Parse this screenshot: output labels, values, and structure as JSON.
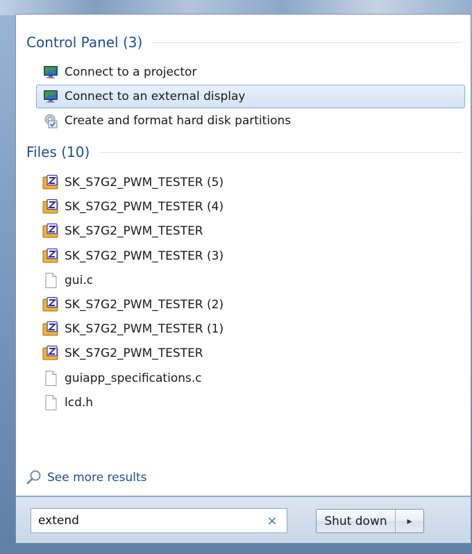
{
  "control_panel": {
    "header": "Control Panel (3)",
    "items": [
      {
        "label": "Connect to a projector",
        "icon": "monitor-icon",
        "selected": false
      },
      {
        "label": "Connect to an external display",
        "icon": "monitor-icon",
        "selected": true
      },
      {
        "label": "Create and format hard disk partitions",
        "icon": "disk-management-icon",
        "selected": false
      }
    ]
  },
  "files": {
    "header": "Files (10)",
    "items": [
      {
        "label": "SK_S7G2_PWM_TESTER (5)",
        "icon": "project-file-icon"
      },
      {
        "label": "SK_S7G2_PWM_TESTER (4)",
        "icon": "project-file-icon"
      },
      {
        "label": "SK_S7G2_PWM_TESTER",
        "icon": "project-file-icon"
      },
      {
        "label": "SK_S7G2_PWM_TESTER (3)",
        "icon": "project-file-icon"
      },
      {
        "label": "gui.c",
        "icon": "document-icon"
      },
      {
        "label": "SK_S7G2_PWM_TESTER (2)",
        "icon": "project-file-icon"
      },
      {
        "label": "SK_S7G2_PWM_TESTER (1)",
        "icon": "project-file-icon"
      },
      {
        "label": "SK_S7G2_PWM_TESTER",
        "icon": "project-file-icon"
      },
      {
        "label": "guiapp_specifications.c",
        "icon": "document-icon"
      },
      {
        "label": "lcd.h",
        "icon": "document-icon"
      }
    ]
  },
  "see_more": "See more results",
  "search": {
    "value": "extend",
    "clear_glyph": "×"
  },
  "shutdown": {
    "label": "Shut down",
    "arrow_glyph": "▸"
  },
  "colors": {
    "accent": "#1e4e8c",
    "selection": "#d3e3f6",
    "selection_border": "#84acd9"
  }
}
